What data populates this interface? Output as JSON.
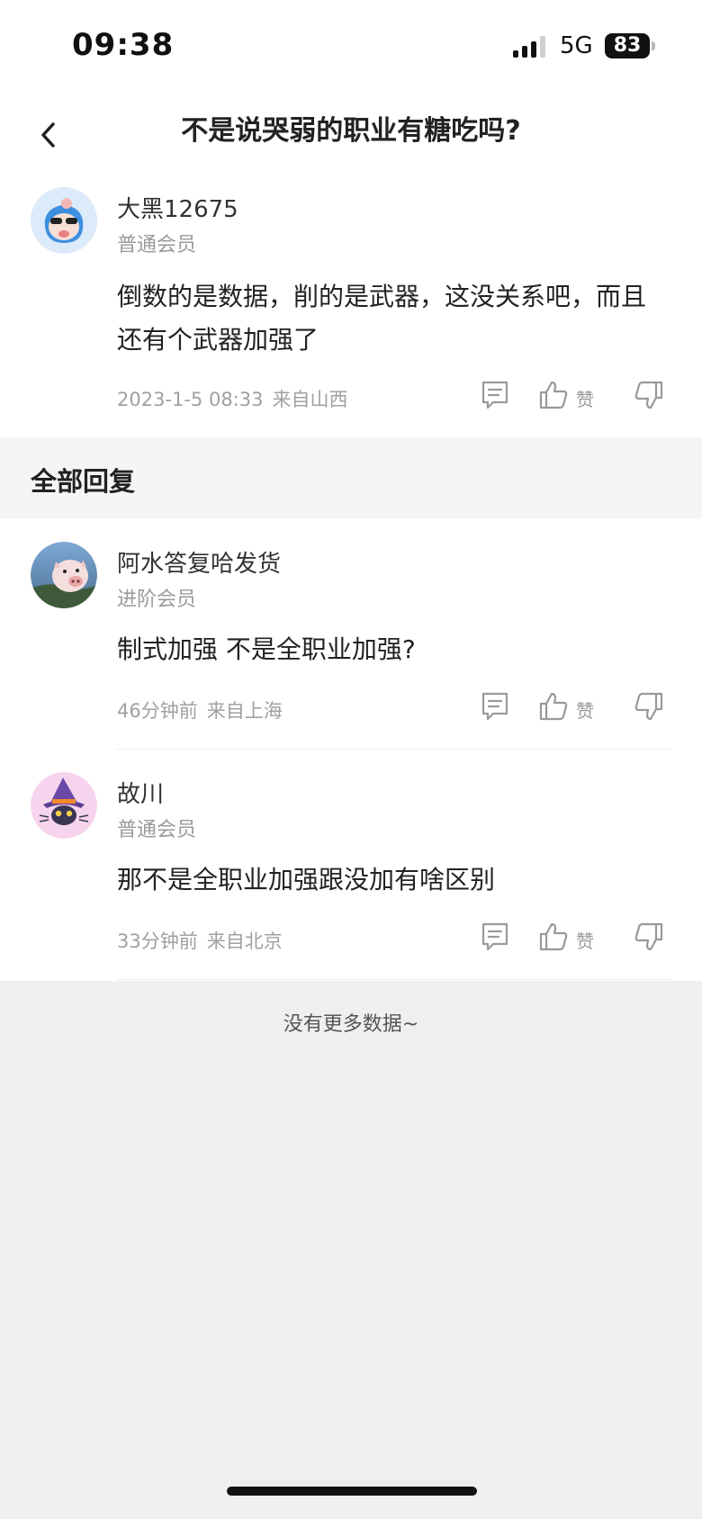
{
  "status": {
    "time": "09:38",
    "network": "5G",
    "battery": "83"
  },
  "nav": {
    "title": "不是说哭弱的职业有糖吃吗?"
  },
  "post": {
    "username": "大黑12675",
    "level": "普通会员",
    "content": "倒数的是数据，削的是武器，这没关系吧，而且还有个武器加强了",
    "time": "2023-1-5 08:33",
    "location": "来自山西",
    "like_label": "赞"
  },
  "section": {
    "title": "全部回复"
  },
  "replies": [
    {
      "username": "阿水答复哈发货",
      "level": "进阶会员",
      "content": "制式加强 不是全职业加强?",
      "time": "46分钟前",
      "location": "来自上海",
      "like_label": "赞"
    },
    {
      "username": "故川",
      "level": "普通会员",
      "content": "那不是全职业加强跟没加有啥区别",
      "time": "33分钟前",
      "location": "来自北京",
      "like_label": "赞"
    }
  ],
  "footer": {
    "no_more": "没有更多数据~"
  },
  "icons": [
    "back-icon",
    "comment-icon",
    "like-icon",
    "dislike-icon",
    "signal-icon",
    "battery-icon"
  ]
}
